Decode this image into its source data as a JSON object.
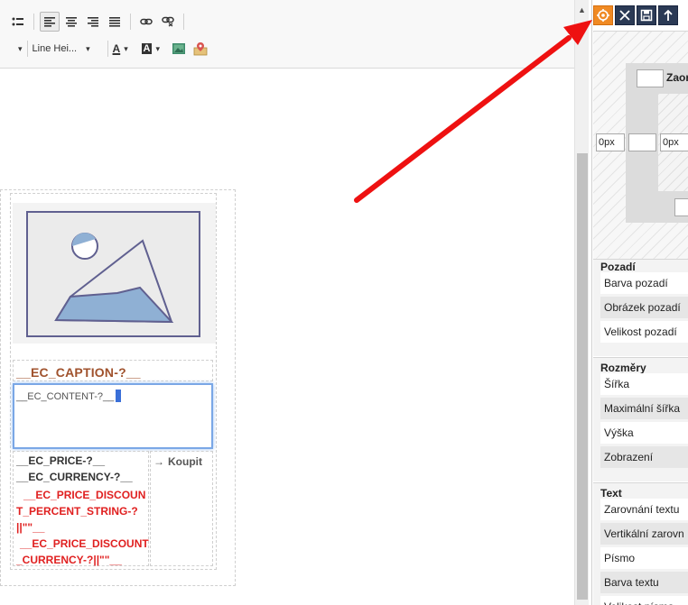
{
  "toolbar": {
    "row1_icons": [
      "list-bullet-icon",
      "align-left-icon",
      "align-center-icon",
      "align-right-icon",
      "align-justify-icon",
      "link-icon",
      "unlink-icon"
    ],
    "line_height_label": "Line Hei...",
    "font_color_label": "A",
    "bg_color_label": "A"
  },
  "editor": {
    "caption": "__EC_CAPTION-?__",
    "content": "__EC_CONTENT-?__",
    "price": "__EC_PRICE-?__",
    "currency": "__EC_CURRENCY-?__",
    "discount_percent_line1": "__EC_PRICE_DISCOUN",
    "discount_percent_line2": "T_PERCENT_STRING-?",
    "discount_percent_line3": "||\"\"__",
    "discount_line1": "__EC_PRICE_DISCOUNT",
    "discount_line2": "_CURRENCY-?||\"\"__",
    "buy_label": "Koupit"
  },
  "panel": {
    "head_buttons": [
      "style-settings-icon",
      "close-icon",
      "save-icon",
      "move-up-icon"
    ],
    "box_model": {
      "label": "Zaor",
      "left_value": "0px",
      "right_value": "0px"
    },
    "sections": [
      {
        "title": "Pozadí",
        "props": [
          "Barva pozadí",
          "Obrázek pozadí",
          "Velikost pozadí"
        ]
      },
      {
        "title": "Rozměry",
        "props": [
          "Šířka",
          "Maximální šířka",
          "Výška",
          "Zobrazení"
        ]
      },
      {
        "title": "Text",
        "props": [
          "Zarovnání textu",
          "Vertikální zarovn",
          "Písmo",
          "Barva textu",
          "Velikost písma"
        ]
      }
    ]
  },
  "colors": {
    "accent_orange": "#f08a24",
    "panel_dark": "#2b3a55",
    "caption_color": "#a0522d",
    "discount_red": "#e02020",
    "arrow_red": "#ee1111"
  }
}
